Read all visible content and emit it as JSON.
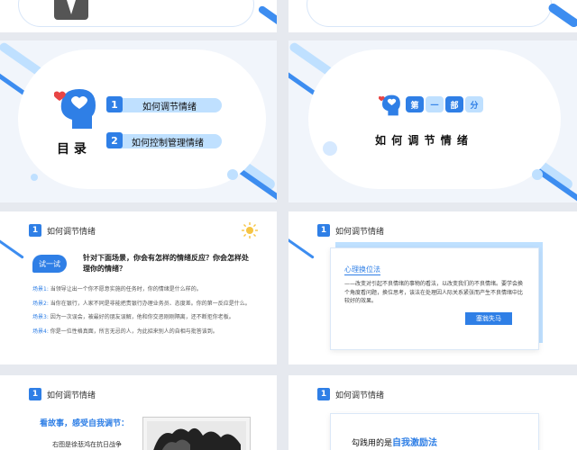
{
  "slide_top_left": {},
  "slide_top_right": {},
  "slide_toc": {
    "title": "目 录",
    "items": [
      {
        "num": "1",
        "label": "如何调节情绪"
      },
      {
        "num": "2",
        "label": "如何控制管理情绪"
      }
    ]
  },
  "slide_part": {
    "badge_chars": [
      "第",
      "一",
      "部",
      "分"
    ],
    "title": "如 何 调 节 情 绪"
  },
  "slide_scenario": {
    "header_num": "1",
    "header_label": "如何调节情绪",
    "try_label": "试一试",
    "question": "针对下面场景，你会有怎样的情绪反应？你会怎样处理你的情绪？",
    "scenes": [
      {
        "label": "场景1:",
        "text": "当领导让出一个你不愿意实施的任务时，你的情绪是什么样的。"
      },
      {
        "label": "场景2:",
        "text": "当你在银行，人家不同是非能把责银行办理业务员、态度差。你的第一反应是什么。"
      },
      {
        "label": "场景3:",
        "text": "因为一次误会，被最好的朋友误解，他和你交恶刚刚隔离，还不断拒你老板。"
      },
      {
        "label": "场景4:",
        "text": "你是一位性格真面，所言无忌的人，为此招来别人的自相与批答该到。"
      }
    ]
  },
  "slide_psych": {
    "header_num": "1",
    "header_label": "如何调节情绪",
    "subtitle": "心理换位法",
    "body": "——改变对引起不良情绪的事物的看法，以改变我们的不良情绪。要学会换个角度看问题，换位思考，该法在处理因人际关系紧张而产生不良情绪中比较好的效果。",
    "tag": "塞翁失马"
  },
  "slide_story": {
    "header_num": "1",
    "header_label": "如何调节情绪",
    "heading": "看故事，感受自我调节：",
    "text": "右图是徐悲鸿在抗日战争"
  },
  "slide_incentive": {
    "header_num": "1",
    "header_label": "如何调节情绪",
    "prefix": "勾践用的是",
    "highlight": "自我激励法"
  }
}
